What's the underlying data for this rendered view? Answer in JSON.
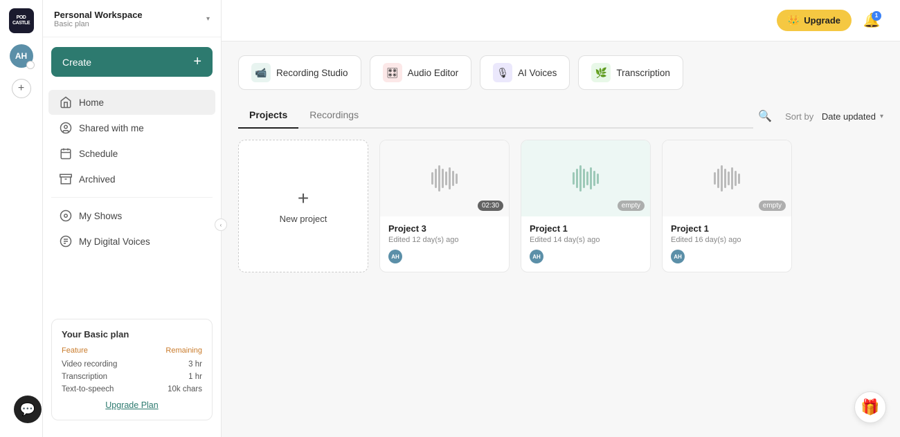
{
  "app": {
    "logo": "PODCASTLE",
    "workspace": {
      "name": "Personal Workspace",
      "plan": "Basic plan"
    },
    "avatar_initials": "AH"
  },
  "header": {
    "upgrade_label": "Upgrade",
    "notification_count": "1"
  },
  "sidebar": {
    "create_label": "Create",
    "nav_items": [
      {
        "id": "home",
        "label": "Home",
        "active": true
      },
      {
        "id": "shared",
        "label": "Shared with me",
        "active": false
      },
      {
        "id": "schedule",
        "label": "Schedule",
        "active": false
      },
      {
        "id": "archived",
        "label": "Archived",
        "active": false
      }
    ],
    "secondary_nav": [
      {
        "id": "myshows",
        "label": "My Shows"
      },
      {
        "id": "digitalvoices",
        "label": "My Digital Voices"
      }
    ],
    "plan_card": {
      "title": "Your Basic plan",
      "feature_header": "Feature",
      "remaining_header": "Remaining",
      "features": [
        {
          "name": "Video recording",
          "value": "3 hr"
        },
        {
          "name": "Transcription",
          "value": "1 hr"
        },
        {
          "name": "Text-to-speech",
          "value": "10k chars"
        }
      ],
      "upgrade_link": "Upgrade Plan"
    }
  },
  "quick_actions": [
    {
      "id": "recording-studio",
      "label": "Recording Studio",
      "icon": "🎥"
    },
    {
      "id": "audio-editor",
      "label": "Audio Editor",
      "icon": "🎛"
    },
    {
      "id": "ai-voices",
      "label": "AI Voices",
      "icon": "🎙"
    },
    {
      "id": "transcription",
      "label": "Transcription",
      "icon": "🌿"
    }
  ],
  "tabs": {
    "items": [
      {
        "id": "projects",
        "label": "Projects",
        "active": true
      },
      {
        "id": "recordings",
        "label": "Recordings",
        "active": false
      }
    ],
    "sort_label": "Sort by",
    "sort_value": "Date updated"
  },
  "projects": [
    {
      "id": "new",
      "is_new": true,
      "label": "New project"
    },
    {
      "id": "project3",
      "title": "Project 3",
      "subtitle": "Edited 12 day(s) ago",
      "badge": "02:30",
      "badge_type": "time",
      "thumb_color": "default"
    },
    {
      "id": "project1a",
      "title": "Project 1",
      "subtitle": "Edited 14 day(s) ago",
      "badge": "empty",
      "badge_type": "empty",
      "thumb_color": "green"
    },
    {
      "id": "project1b",
      "title": "Project 1",
      "subtitle": "Edited 16 day(s) ago",
      "badge": "empty",
      "badge_type": "empty",
      "thumb_color": "default"
    }
  ]
}
